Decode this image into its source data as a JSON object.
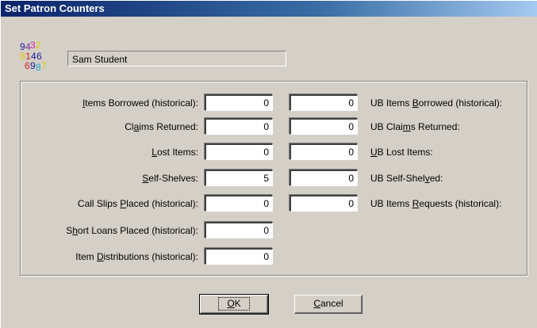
{
  "window": {
    "title": "Set Patron Counters"
  },
  "patron": {
    "name": "Sam Student"
  },
  "icon": {
    "name": "patron-counters-icon",
    "digits": [
      "9",
      "4",
      "3",
      "2",
      "8",
      "1",
      "4",
      "6",
      "6",
      "9",
      "8",
      "7"
    ],
    "colors": [
      "#1a1a9e",
      "#7a2fa0",
      "#d0209a",
      "#e8c400",
      "#e8c400",
      "#d02020",
      "#1a1a9e",
      "#1a1a9e",
      "#d02020",
      "#1a1a9e",
      "#20a0d0",
      "#e8c400"
    ]
  },
  "local_counters": [
    {
      "pre": "",
      "key": "I",
      "post": "tems Borrowed (historical):",
      "value": "0"
    },
    {
      "pre": "Cl",
      "key": "a",
      "post": "ims Returned:",
      "value": "0"
    },
    {
      "pre": "",
      "key": "L",
      "post": "ost Items:",
      "value": "0"
    },
    {
      "pre": "",
      "key": "S",
      "post": "elf-Shelves:",
      "value": "5"
    },
    {
      "pre": "Call Slips ",
      "key": "P",
      "post": "laced (historical):",
      "value": "0"
    },
    {
      "pre": "S",
      "key": "h",
      "post": "ort Loans Placed (historical):",
      "value": "0"
    },
    {
      "pre": "Item ",
      "key": "D",
      "post": "istributions (historical):",
      "value": "0"
    }
  ],
  "ub_counters": [
    {
      "pre": "UB Items ",
      "key": "B",
      "post": "orrowed (historical):",
      "value": "0"
    },
    {
      "pre": "UB Clai",
      "key": "m",
      "post": "s Returned:",
      "value": "0"
    },
    {
      "pre": "",
      "key": "U",
      "post": "B Lost Items:",
      "value": "0"
    },
    {
      "pre": "UB Self-Shel",
      "key": "v",
      "post": "ed:",
      "value": "0"
    },
    {
      "pre": "UB Items ",
      "key": "R",
      "post": "equests (historical):",
      "value": "0"
    }
  ],
  "buttons": {
    "ok": {
      "pre": "",
      "key": "O",
      "post": "K"
    },
    "cancel": {
      "pre": "",
      "key": "C",
      "post": "ancel"
    }
  }
}
